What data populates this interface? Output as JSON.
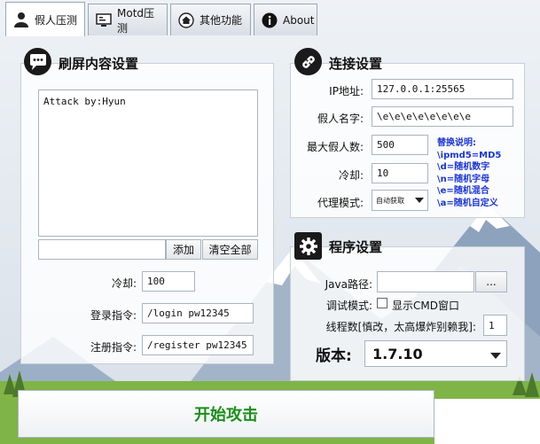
{
  "tabs": [
    {
      "label": "假人压测",
      "icon": "person-icon",
      "active": true
    },
    {
      "label": "Motd压测",
      "icon": "monitor-icon",
      "active": false
    },
    {
      "label": "其他功能",
      "icon": "home-icon",
      "active": false
    },
    {
      "label": "About",
      "icon": "info-icon",
      "active": false
    }
  ],
  "spam": {
    "title": "刷屏内容设置",
    "icon": "chat-icon",
    "content": "Attack by:Hyun",
    "add_input": "",
    "add_button": "添加",
    "clear_button": "清空全部",
    "cooldown_label": "冷却:",
    "cooldown_value": "100",
    "login_label": "登录指令:",
    "login_value": "/login pw12345",
    "register_label": "注册指令:",
    "register_value": "/register pw12345"
  },
  "connection": {
    "title": "连接设置",
    "icon": "link-icon",
    "ip_label": "IP地址:",
    "ip_value": "127.0.0.1:25565",
    "name_label": "假人名字:",
    "name_value": "\\e\\e\\e\\e\\e\\e\\e\\e",
    "max_label": "最大假人数:",
    "max_value": "500",
    "cooldown_label": "冷却:",
    "cooldown_value": "10",
    "proxy_label": "代理模式:",
    "proxy_value": "自动获取",
    "notes": [
      "替换说明:",
      "\\ipmd5=MD5",
      "\\d=随机数字",
      "\\n=随机字母",
      "\\e=随机混合",
      "\\a=随机自定义"
    ]
  },
  "program": {
    "title": "程序设置",
    "icon": "gear-icon",
    "java_label": "Java路径:",
    "java_value": "",
    "browse_button": "...",
    "debug_label": "调试模式:",
    "debug_checkbox_label": "显示CMD窗口",
    "debug_checked": false,
    "threads_label": "线程数[慎改，太高爆炸别赖我]:",
    "threads_value": "1",
    "version_label": "版本:",
    "version_value": "1.7.10"
  },
  "start_button": "开始攻击",
  "colors": {
    "start_text": "#1a8f1a",
    "note_text": "#1b35d6",
    "sky_top": "#e9eef4",
    "mountain": "#98abc1",
    "snow": "#ffffff",
    "grass": "#79b440"
  }
}
